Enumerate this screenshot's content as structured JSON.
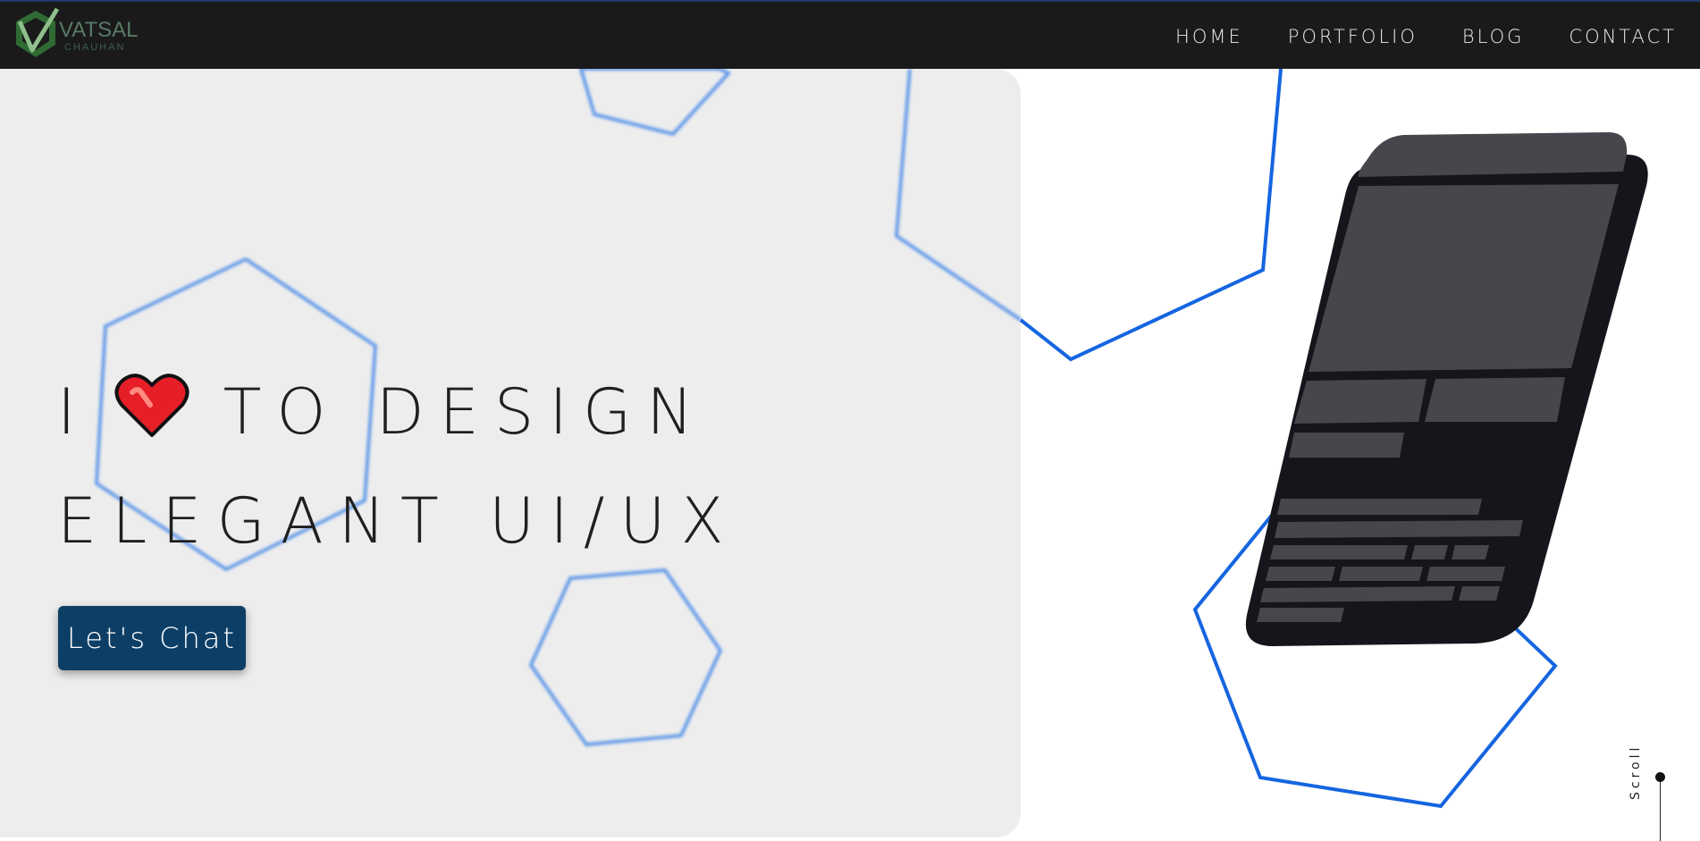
{
  "brand": {
    "name": "VATSAL",
    "sub": "CHAUHAN"
  },
  "nav": {
    "items": [
      "HOME",
      "PORTFOLIO",
      "BLOG",
      "CONTACT"
    ]
  },
  "hero": {
    "line1_prefix": "I",
    "line1_suffix": "TO DESIGN",
    "line2": "ELEGANT UI/UX",
    "cta_label": "Let's Chat"
  },
  "scroll": {
    "label": "Scroll"
  },
  "icons": {
    "logo": "v-check-logo-icon",
    "heart": "heart-icon",
    "device": "phone-mockup-icon"
  },
  "colors": {
    "accent": "#1565e0",
    "cta": "#0d3f66",
    "topbar": "#1a1a1b",
    "logo": "#3c7a3e"
  }
}
